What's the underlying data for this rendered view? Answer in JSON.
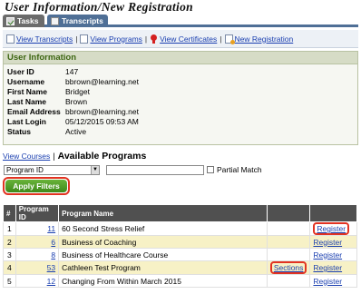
{
  "page": {
    "title": "User Information/New Registration"
  },
  "tabs": [
    {
      "label": "Tasks",
      "icon": "checklist-icon"
    },
    {
      "label": "Transcripts",
      "icon": "transcript-icon"
    }
  ],
  "toolbar": {
    "links": [
      {
        "label": "View Transcripts",
        "icon": "document-icon"
      },
      {
        "label": "View Programs",
        "icon": "document-icon"
      },
      {
        "label": "View Certificates",
        "icon": "ribbon-icon"
      },
      {
        "label": "New Registration",
        "icon": "new-document-icon"
      }
    ]
  },
  "user_info": {
    "header": "User Information",
    "fields": [
      {
        "label": "User ID",
        "value": "147"
      },
      {
        "label": "Username",
        "value": "bbrown@learning.net"
      },
      {
        "label": "First Name",
        "value": "Bridget"
      },
      {
        "label": "Last Name",
        "value": "Brown"
      },
      {
        "label": "Email Address",
        "value": "bbrown@learning.net"
      },
      {
        "label": "Last Login",
        "value": "05/12/2015 09:53 AM"
      },
      {
        "label": "Status",
        "value": "Active"
      }
    ]
  },
  "programs": {
    "view_courses_link": "View Courses",
    "separator": "|",
    "title": "Available Programs",
    "filter": {
      "select_value": "Program ID",
      "input_value": "",
      "partial_match_label": "Partial Match",
      "apply_label": "Apply Filters"
    },
    "columns": [
      "#",
      "Program ID",
      "Program Name",
      "",
      ""
    ],
    "rows": [
      {
        "num": "1",
        "id": "11",
        "name": "60 Second Stress Relief",
        "sections": "",
        "register": "Register"
      },
      {
        "num": "2",
        "id": "6",
        "name": "Business of Coaching",
        "sections": "",
        "register": "Register"
      },
      {
        "num": "3",
        "id": "8",
        "name": "Business of Healthcare Course",
        "sections": "",
        "register": "Register"
      },
      {
        "num": "4",
        "id": "53",
        "name": "Cathleen Test Program",
        "sections": "Sections",
        "register": "Register"
      },
      {
        "num": "5",
        "id": "12",
        "name": "Changing From Within March 2015",
        "sections": "",
        "register": "Register"
      }
    ]
  },
  "colors": {
    "accent_highlight": "#e23322",
    "tab_active": "#4f6f96",
    "apply_button": "#4f9a26",
    "row_alt": "#f7f1c6"
  }
}
